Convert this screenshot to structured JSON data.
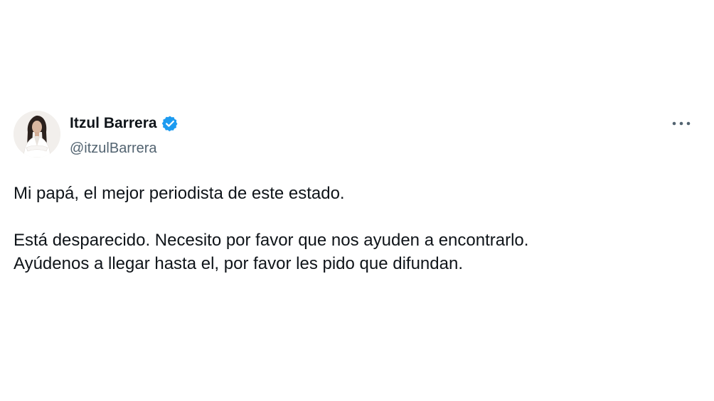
{
  "author": {
    "display_name": "Itzul Barrera",
    "handle": "@itzulBarrera",
    "verified": true,
    "verified_color": "#1d9bf0"
  },
  "tweet": {
    "paragraphs": [
      "Mi papá, el mejor periodista de este estado.",
      "Está desparecido. Necesito por favor que nos ayuden a encontrarlo.",
      "Ayúdenos a llegar hasta el, por favor les pido que difundan."
    ]
  },
  "icons": {
    "more": "more-horizontal-icon",
    "verified": "verified-badge-icon",
    "avatar": "profile-photo"
  }
}
